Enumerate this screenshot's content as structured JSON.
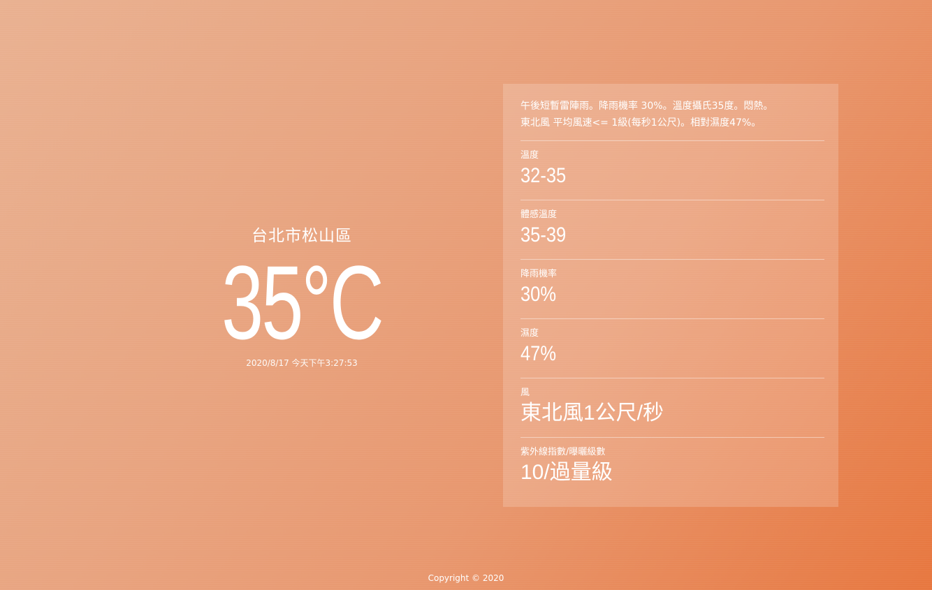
{
  "location": "台北市松山區",
  "temperature": "35°C",
  "datetime": "2020/8/17 今天下午3:27:53",
  "summary": {
    "line1": "午後短暫雷陣雨。降雨機率 30%。溫度攝氏35度。悶熱。",
    "line2": "東北風 平均風速<= 1級(每秒1公尺)。相對濕度47%。"
  },
  "details": [
    {
      "label": "溫度",
      "value": "32-35"
    },
    {
      "label": "體感溫度",
      "value": "35-39"
    },
    {
      "label": "降雨機率",
      "value": "30%"
    },
    {
      "label": "濕度",
      "value": "47%"
    },
    {
      "label": "風",
      "value": "東北風1公尺/秒"
    },
    {
      "label": "紫外線指數/曝曬級數",
      "value": "10/過量級"
    }
  ],
  "footer": "Copyright © 2020",
  "colors": {
    "background_start": "#e9b191",
    "background_end": "#e7773f",
    "text": "#ffffff"
  }
}
